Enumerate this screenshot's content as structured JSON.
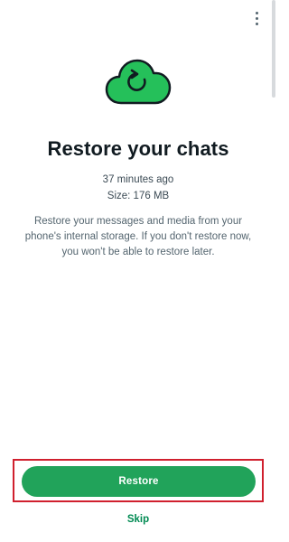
{
  "menu": {
    "overflow_icon": "more-vert-icon"
  },
  "hero": {
    "icon": "cloud-restore-icon",
    "cloud_color": "#25c05a",
    "outline_color": "#111b21"
  },
  "restore": {
    "title": "Restore your chats",
    "last_backup": "37 minutes ago",
    "size": "Size: 176 MB",
    "description": "Restore your messages and media from your phone's internal storage. If you don't restore now, you won't be able to restore later."
  },
  "actions": {
    "restore_label": "Restore",
    "skip_label": "Skip",
    "accent_color": "#21a35a",
    "highlight_color": "#d0202e"
  }
}
